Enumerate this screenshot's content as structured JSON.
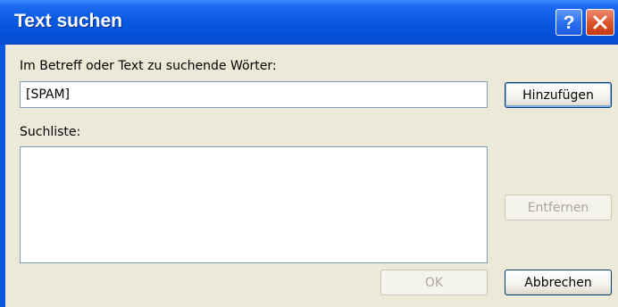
{
  "window": {
    "title": "Text suchen",
    "help_label": "?",
    "accent": "#0a58e0",
    "close_color": "#d8522c"
  },
  "search": {
    "label": "Im Betreff oder Text zu suchende Wörter:",
    "value": "[SPAM]"
  },
  "buttons": {
    "add": "Hinzufügen",
    "remove": "Entfernen",
    "ok": "OK",
    "cancel": "Abbrechen"
  },
  "list": {
    "label": "Suchliste:",
    "items": []
  }
}
